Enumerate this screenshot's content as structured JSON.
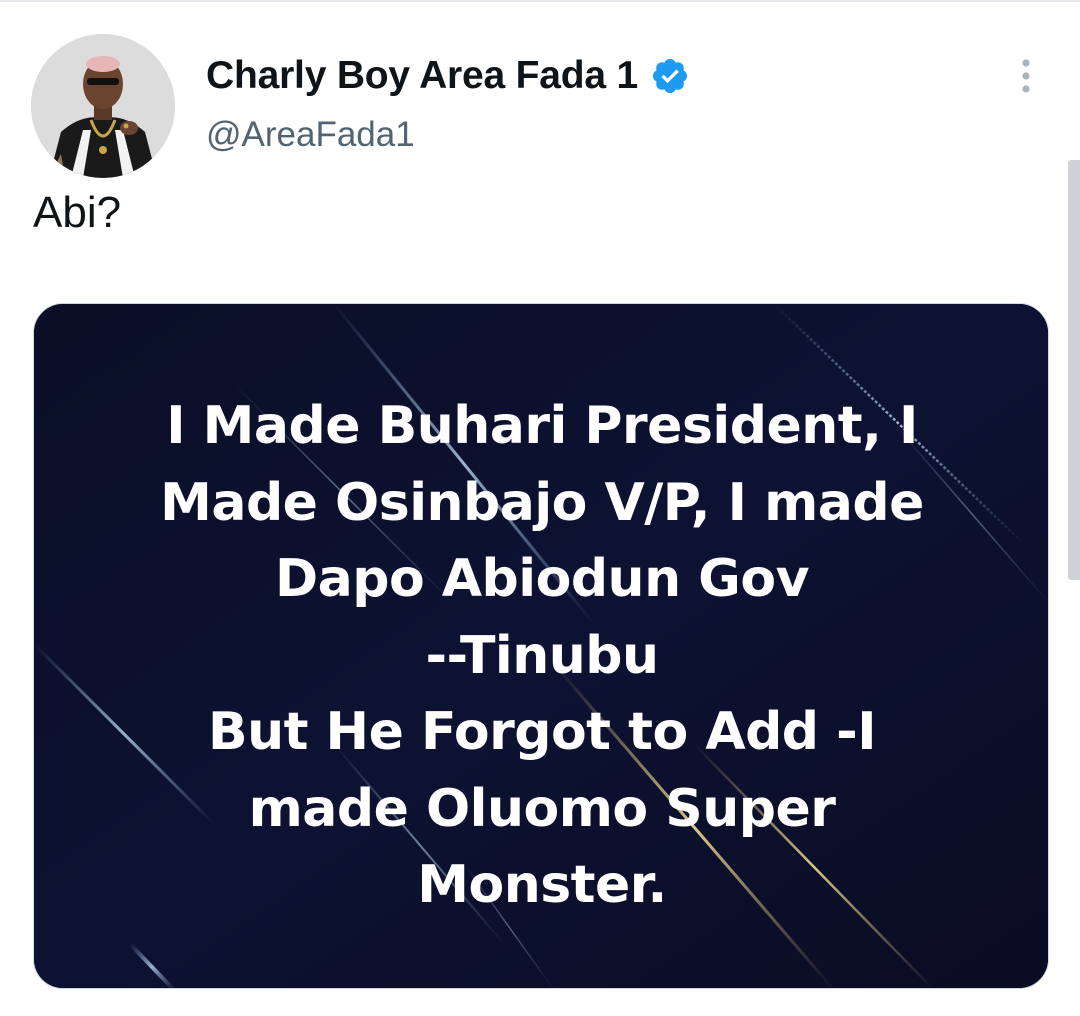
{
  "tweet": {
    "display_name": "Charly Boy Area Fada 1",
    "handle": "@AreaFada1",
    "text": "Abi?",
    "verified": true,
    "more_icon": "vertical-ellipsis-icon",
    "verified_icon": "verified-badge-icon",
    "verified_color": "#1d9bf0"
  },
  "media": {
    "lines": [
      "I Made Buhari President, I",
      "Made Osinbajo V/P, I made",
      "Dapo Abiodun Gov",
      "--Tinubu",
      "But He Forgot to Add -I",
      "made Oluomo Super",
      "Monster."
    ],
    "background_color": "#0b0f2a"
  },
  "colors": {
    "text_primary": "#0f1419",
    "text_secondary": "#536471",
    "accent": "#1d9bf0"
  }
}
